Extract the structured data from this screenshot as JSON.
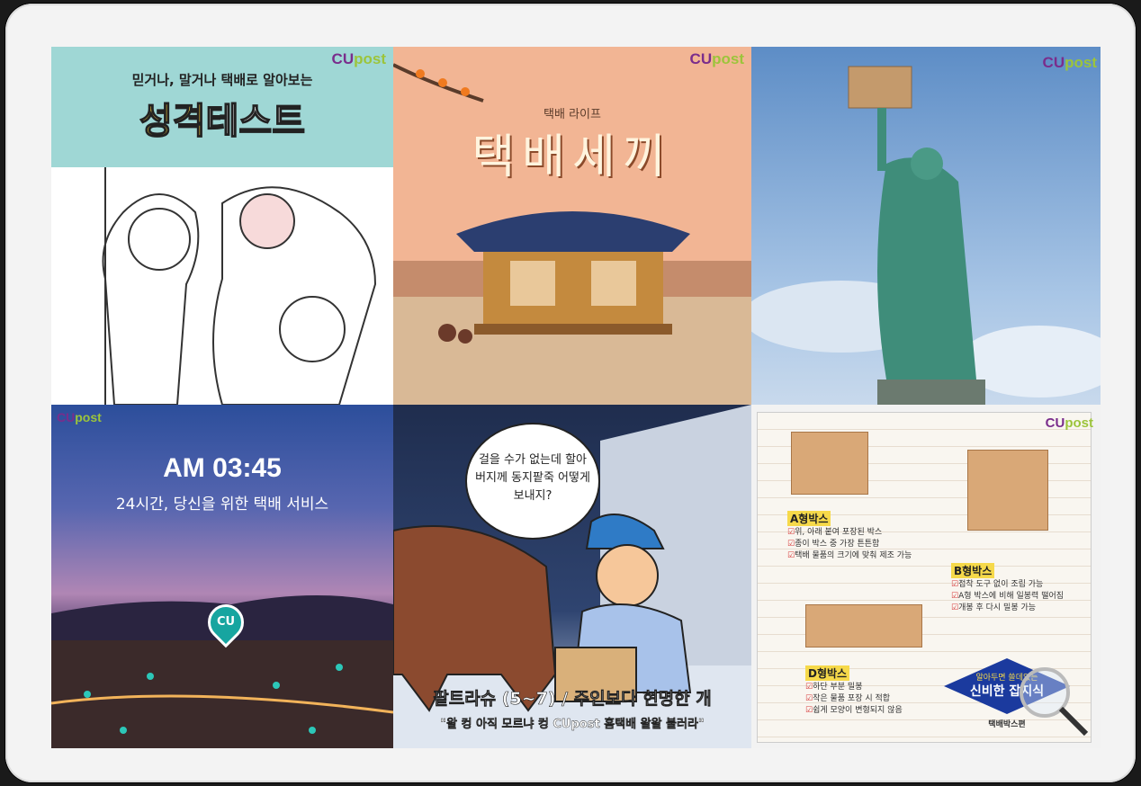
{
  "brand": {
    "cu": "CU",
    "post": "post"
  },
  "tiles": {
    "personality_test": {
      "subtitle": "믿거나, 말거나 택배로 알아보는",
      "title_highlight": "성격",
      "title_rest": "테스트"
    },
    "delivery_life": {
      "subtitle": "택배 라이프",
      "title": "택배세끼"
    },
    "service_24h": {
      "time": "AM 03:45",
      "subtitle": "24시간, 당신을 위한 택배 서비스",
      "pin": "CU"
    },
    "comic": {
      "bubble": "걸을 수가 없는데 할아버지께 동지팥죽 어떻게 보내지?",
      "caption": "팥트라슈 (5~7) / 주인보다 현명한 개",
      "tagline": "\"왈 컹 아직 모르냐 컹 CUpost 홈택배 왈왈 불러라\""
    },
    "box_guide": {
      "boxes": [
        {
          "label": "A형박스",
          "items": [
            "위, 아래 붙여 포장된 박스",
            "종이 박스 중 가장 튼튼함",
            "택배 물품의 크기에 맞춰 제조 가능"
          ]
        },
        {
          "label": "B형박스",
          "items": [
            "접착 도구 없이 조립 가능",
            "A형 박스에 비해 일봉력 떨어짐",
            "개봉 후 다시 밀봉 가능"
          ]
        },
        {
          "label": "D형박스",
          "items": [
            "하단 부분 밀봉",
            "작은 물품 포장 시 적합",
            "쉽게 모양이 변형되지 않음"
          ]
        }
      ],
      "badge_top": "알아두면 쓸데있는",
      "badge_main": "신비한 잡지식",
      "badge_foot": "택배박스편"
    }
  }
}
